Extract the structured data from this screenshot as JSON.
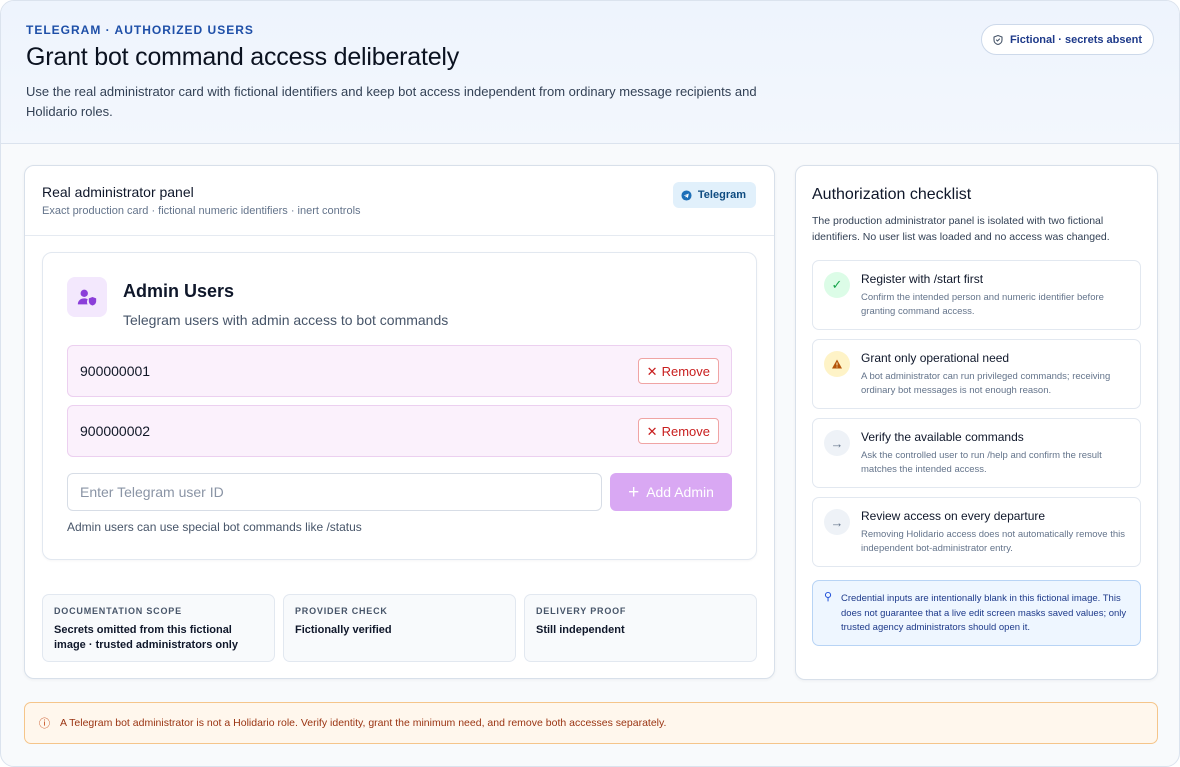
{
  "header": {
    "eyebrow": "TELEGRAM · AUTHORIZED USERS",
    "title": "Grant bot command access deliberately",
    "description": "Use the real administrator card with fictional identifiers and keep bot access independent from ordinary message recipients and Holidario roles.",
    "badge": "Fictional · secrets absent"
  },
  "admin_card": {
    "title": "Real administrator panel",
    "subtitle": "Exact production card · fictional numeric identifiers · inert controls",
    "badge": "Telegram",
    "panel": {
      "icon": "user-shield-icon",
      "title": "Admin Users",
      "subtitle": "Telegram users with admin access to bot commands",
      "users": [
        {
          "id": "900000001",
          "remove_label": "Remove"
        },
        {
          "id": "900000002",
          "remove_label": "Remove"
        }
      ],
      "input_placeholder": "Enter Telegram user ID",
      "add_label": "Add Admin",
      "hint": "Admin users can use special bot commands like /status"
    },
    "stats": [
      {
        "label": "DOCUMENTATION SCOPE",
        "value": "Secrets omitted from this fictional image · trusted administrators only"
      },
      {
        "label": "PROVIDER CHECK",
        "value": "Fictionally verified"
      },
      {
        "label": "DELIVERY PROOF",
        "value": "Still independent"
      }
    ]
  },
  "checklist": {
    "title": "Authorization checklist",
    "description": "The production administrator panel is isolated with two fictional identifiers. No user list was loaded and no access was changed.",
    "items": [
      {
        "status": "done",
        "icon": "check-icon",
        "title": "Register with /start first",
        "detail": "Confirm the intended person and numeric identifier before granting command access."
      },
      {
        "status": "warning",
        "icon": "warning-icon",
        "title": "Grant only operational need",
        "detail": "A bot administrator can run privileged commands; receiving ordinary bot messages is not enough reason."
      },
      {
        "status": "pending",
        "icon": "arrow-right-icon",
        "title": "Verify the available commands",
        "detail": "Ask the controlled user to run /help and confirm the result matches the intended access."
      },
      {
        "status": "pending",
        "icon": "arrow-right-icon",
        "title": "Review access on every departure",
        "detail": "Removing Holidario access does not automatically remove this independent bot-administrator entry."
      }
    ],
    "note": "Credential inputs are intentionally blank in this fictional image. This does not guarantee that a live edit screen masks saved values; only trusted agency administrators should open it."
  },
  "footer": {
    "text": "A Telegram bot administrator is not a Holidario role. Verify identity, grant the minimum need, and remove both accesses separately."
  },
  "colors": {
    "accent": "#1e4fa8",
    "purple_accent": "#d9a8f3",
    "danger": "#c81e1e",
    "warning_bg": "#fff7ed"
  }
}
